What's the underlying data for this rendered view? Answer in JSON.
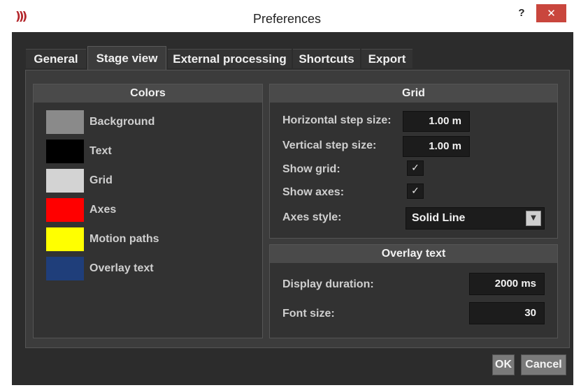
{
  "window": {
    "title": "Preferences",
    "logo": ")))",
    "help_label": "?",
    "close_label": "✕"
  },
  "tabs": [
    {
      "label": "General",
      "active": false
    },
    {
      "label": "Stage view",
      "active": true
    },
    {
      "label": "External processing",
      "active": false
    },
    {
      "label": "Shortcuts",
      "active": false
    },
    {
      "label": "Export",
      "active": false
    }
  ],
  "colors_group": {
    "header": "Colors",
    "items": [
      {
        "label": "Background",
        "color": "#8a8a8a"
      },
      {
        "label": "Text",
        "color": "#000000"
      },
      {
        "label": "Grid",
        "color": "#d3d3d3"
      },
      {
        "label": "Axes",
        "color": "#ff0000"
      },
      {
        "label": "Motion paths",
        "color": "#ffff00"
      },
      {
        "label": "Overlay text",
        "color": "#1f3e7a"
      }
    ]
  },
  "grid_group": {
    "header": "Grid",
    "horizontal_step_label": "Horizontal step size:",
    "horizontal_step_value": "1.00 m",
    "vertical_step_label": "Vertical step size:",
    "vertical_step_value": "1.00 m",
    "show_grid_label": "Show grid:",
    "show_grid_checked": true,
    "show_axes_label": "Show axes:",
    "show_axes_checked": true,
    "axes_style_label": "Axes style:",
    "axes_style_value": "Solid Line"
  },
  "overlay_group": {
    "header": "Overlay text",
    "display_duration_label": "Display duration:",
    "display_duration_value": "2000 ms",
    "font_size_label": "Font size:",
    "font_size_value": "30"
  },
  "buttons": {
    "ok": "OK",
    "cancel": "Cancel"
  },
  "icons": {
    "check": "✓",
    "dropdown_arrow": "▼"
  }
}
